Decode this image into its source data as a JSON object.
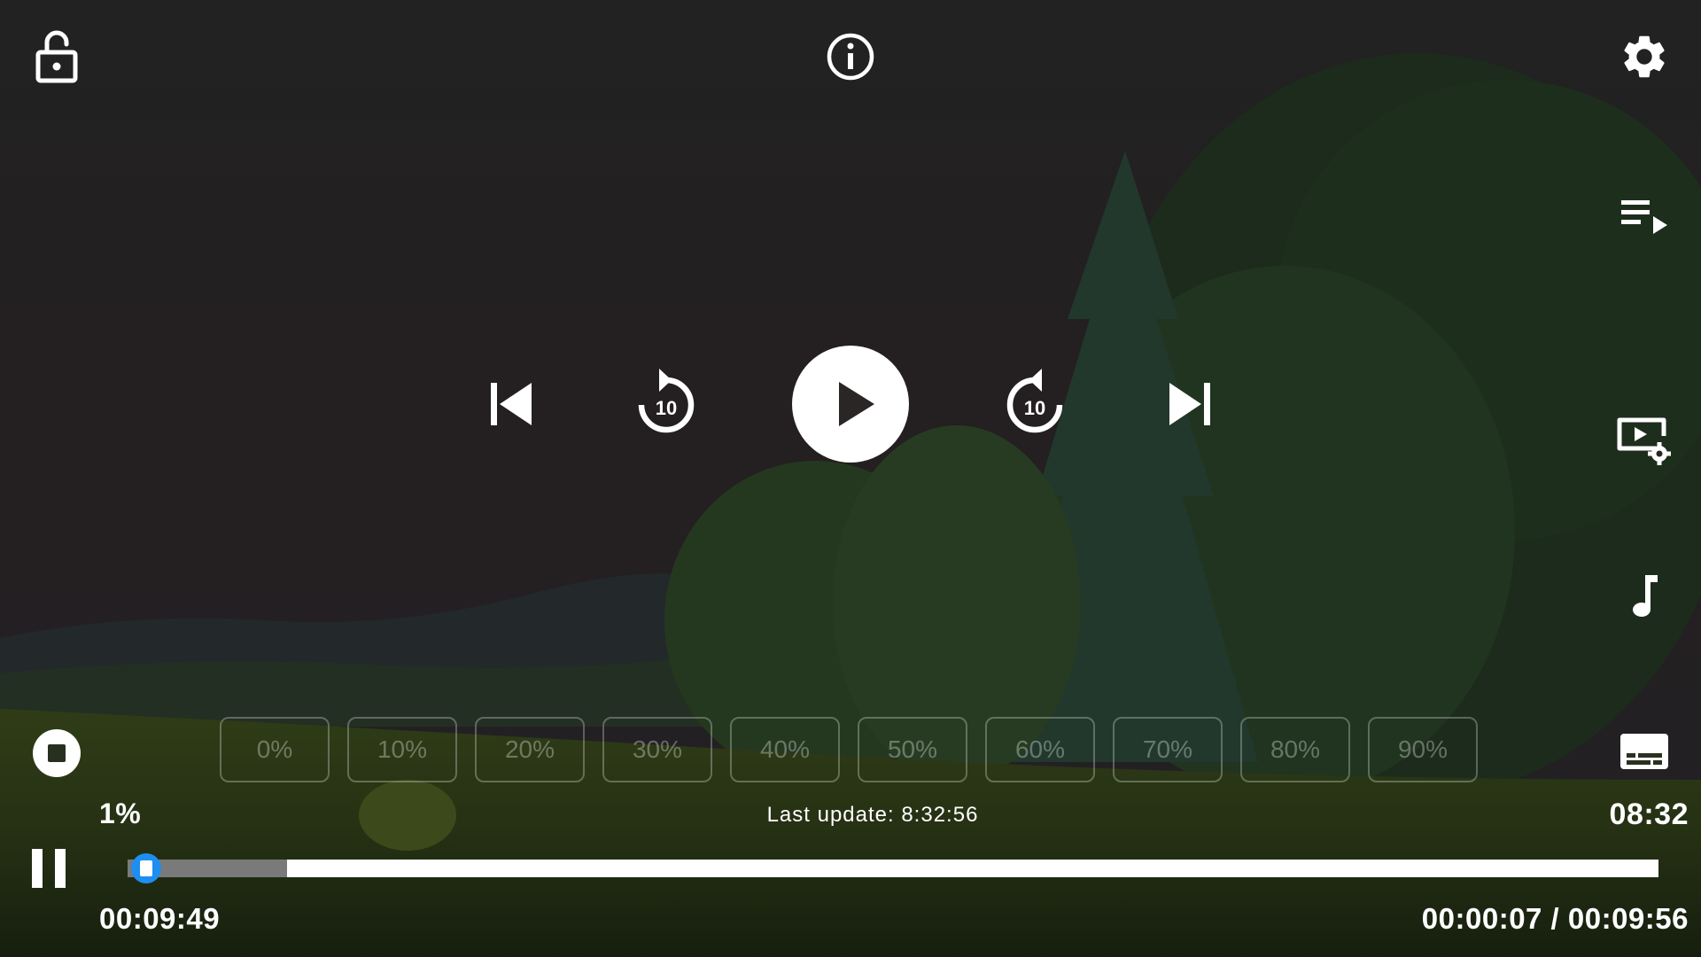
{
  "colors": {
    "accent": "#1e8ef0",
    "chip_text": "rgba(255,255,255,0.32)"
  },
  "top_bar": {
    "lock_icon": "unlock-icon",
    "info_icon": "info-icon",
    "settings_icon": "gear-icon"
  },
  "side_bar": {
    "playlist_icon": "playlist-play-icon",
    "video_settings_icon": "video-settings-icon",
    "audio_icon": "music-note-icon",
    "subtitles_icon": "subtitles-icon"
  },
  "center_controls": {
    "previous_icon": "skip-previous-icon",
    "rewind_icon": "replay-10-icon",
    "rewind_seconds": "10",
    "play_icon": "play-icon",
    "forward_icon": "forward-10-icon",
    "forward_seconds": "10",
    "next_icon": "skip-next-icon"
  },
  "percent_chips": [
    "0%",
    "10%",
    "20%",
    "30%",
    "40%",
    "50%",
    "60%",
    "70%",
    "80%",
    "90%"
  ],
  "status": {
    "percent": "1%",
    "last_update": "Last update: 8:32:56",
    "clock": "08:32"
  },
  "bottom_bar": {
    "stop_icon": "stop-icon",
    "pause_icon": "pause-icon",
    "remaining_time": "00:09:49",
    "position_time": "00:00:07 / 00:09:56",
    "progress_fraction": 0.012,
    "buffer_fraction": 0.104
  }
}
